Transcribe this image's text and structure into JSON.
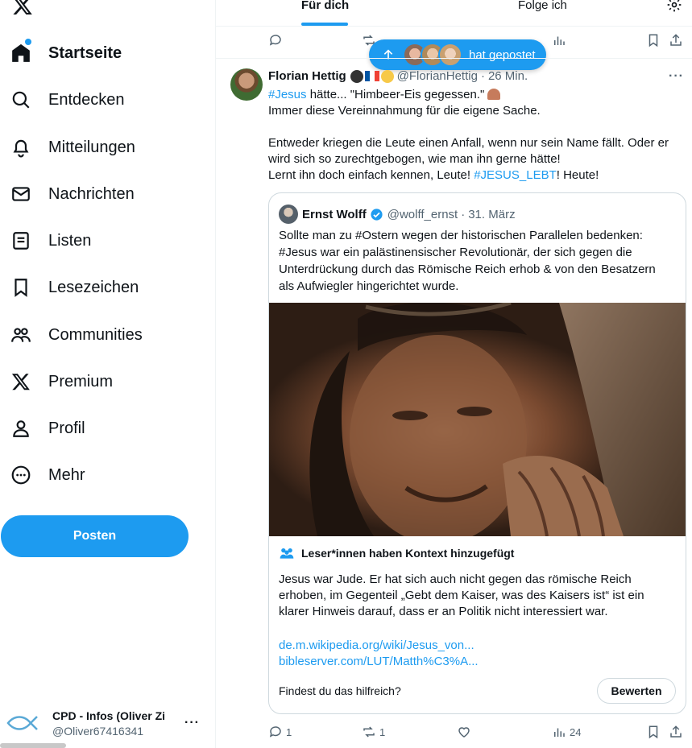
{
  "nav": {
    "items": [
      {
        "label": "Startseite",
        "icon": "home-icon"
      },
      {
        "label": "Entdecken",
        "icon": "search-icon"
      },
      {
        "label": "Mitteilungen",
        "icon": "bell-icon"
      },
      {
        "label": "Nachrichten",
        "icon": "mail-icon"
      },
      {
        "label": "Listen",
        "icon": "list-icon"
      },
      {
        "label": "Lesezeichen",
        "icon": "bookmark-icon"
      },
      {
        "label": "Communities",
        "icon": "people-icon"
      },
      {
        "label": "Premium",
        "icon": "x-logo-icon"
      },
      {
        "label": "Profil",
        "icon": "person-icon"
      },
      {
        "label": "Mehr",
        "icon": "more-circle-icon"
      }
    ],
    "post_button": "Posten"
  },
  "account": {
    "name": "CPD - Infos (Oliver Zi",
    "handle": "@Oliver67416341",
    "more": "···"
  },
  "tabs": {
    "for_you": "Für dich",
    "following": "Folge ich"
  },
  "new_posts_pill": {
    "label": "hat gepostet"
  },
  "tweet": {
    "author_name": "Florian Hettig",
    "handle": "@FlorianHettig",
    "separator": "·",
    "time": "26 Min.",
    "more": "···",
    "line1_hashtag": "#Jesus",
    "line1_rest": " hätte...  \"Himbeer-Eis gegessen.\"",
    "line2": "Immer diese Vereinnahmung für die eigene Sache.",
    "para2_line1": "Entweder kriegen die Leute einen Anfall, wenn nur sein Name fällt. Oder er",
    "para2_line2": "wird sich so zurechtgebogen, wie man ihn gerne hätte!",
    "para2_line3_start": "Lernt ihn doch einfach kennen, Leute! ",
    "para2_line3_hashtag": "#JESUS_LEBT",
    "para2_line3_end": "! Heute!",
    "stats": {
      "replies": "1",
      "reposts": "1",
      "views": "24"
    }
  },
  "quote": {
    "author_name": "Ernst Wolff",
    "handle": "@wolff_ernst",
    "separator": "·",
    "date": "31. März",
    "text_line1": "Sollte man zu #Ostern wegen der historischen Parallelen bedenken:",
    "text_line2": "#Jesus  war ein palästinensischer Revolutionär, der sich gegen die",
    "text_line3": "Unterdrückung durch das Römische Reich erhob & von den Besatzern",
    "text_line4": "als Aufwiegler hingerichtet wurde."
  },
  "community_note": {
    "title": "Leser*innen haben Kontext hinzugefügt",
    "text_line1": "Jesus war Jude. Er hat sich auch nicht gegen das römische Reich",
    "text_line2": "erhoben, im Gegenteil „Gebt dem Kaiser, was des Kaisers ist“ ist ein",
    "text_line3": "klarer Hinweis darauf, dass er an Politik nicht interessiert war.",
    "link1": "de.m.wikipedia.org/wiki/Jesus_von...",
    "link2": "bibleserver.com/LUT/Matth%C3%A...",
    "helpful_question": "Findest du das hilfreich?",
    "rate_button": "Bewerten"
  },
  "colors": {
    "accent": "#1d9bf0",
    "text": "#0f1419",
    "muted": "#536471",
    "border": "#cfd9de"
  }
}
